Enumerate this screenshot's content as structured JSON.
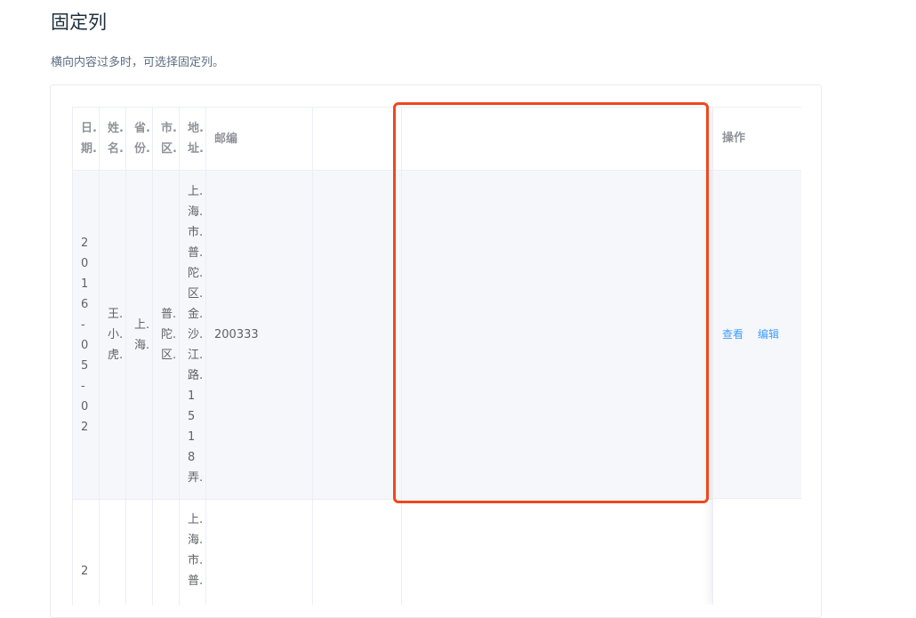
{
  "page": {
    "title": "固定列",
    "description": "横向内容过多时，可选择固定列。"
  },
  "table": {
    "headers": {
      "date": "日.\n期.",
      "name": "姓.\n名.",
      "province": "省.\n份.",
      "city": "市.\n区.",
      "address": "地.\n址.",
      "zip": "邮编",
      "operation": "操作"
    },
    "rows": [
      {
        "date": "2\n0\n1\n6\n-\n0\n5\n-\n0\n2",
        "name": "王.\n小.\n虎.",
        "province": "上.\n海.",
        "city": "普.\n陀.\n区.",
        "address": "上.\n海.\n市.\n普.\n陀.\n区.\n金.\n沙.\n江.\n路.\n1\n5\n1\n8\n弄.",
        "zip": "200333",
        "actions": {
          "view": "查看",
          "edit": "编辑"
        }
      },
      {
        "date": "2",
        "address": "上.\n海.\n市.\n普."
      }
    ]
  },
  "colors": {
    "accent": "#409eff",
    "highlight": "#f0461e",
    "row_stripe": "#f5f7fa",
    "border": "#ebeef5"
  }
}
